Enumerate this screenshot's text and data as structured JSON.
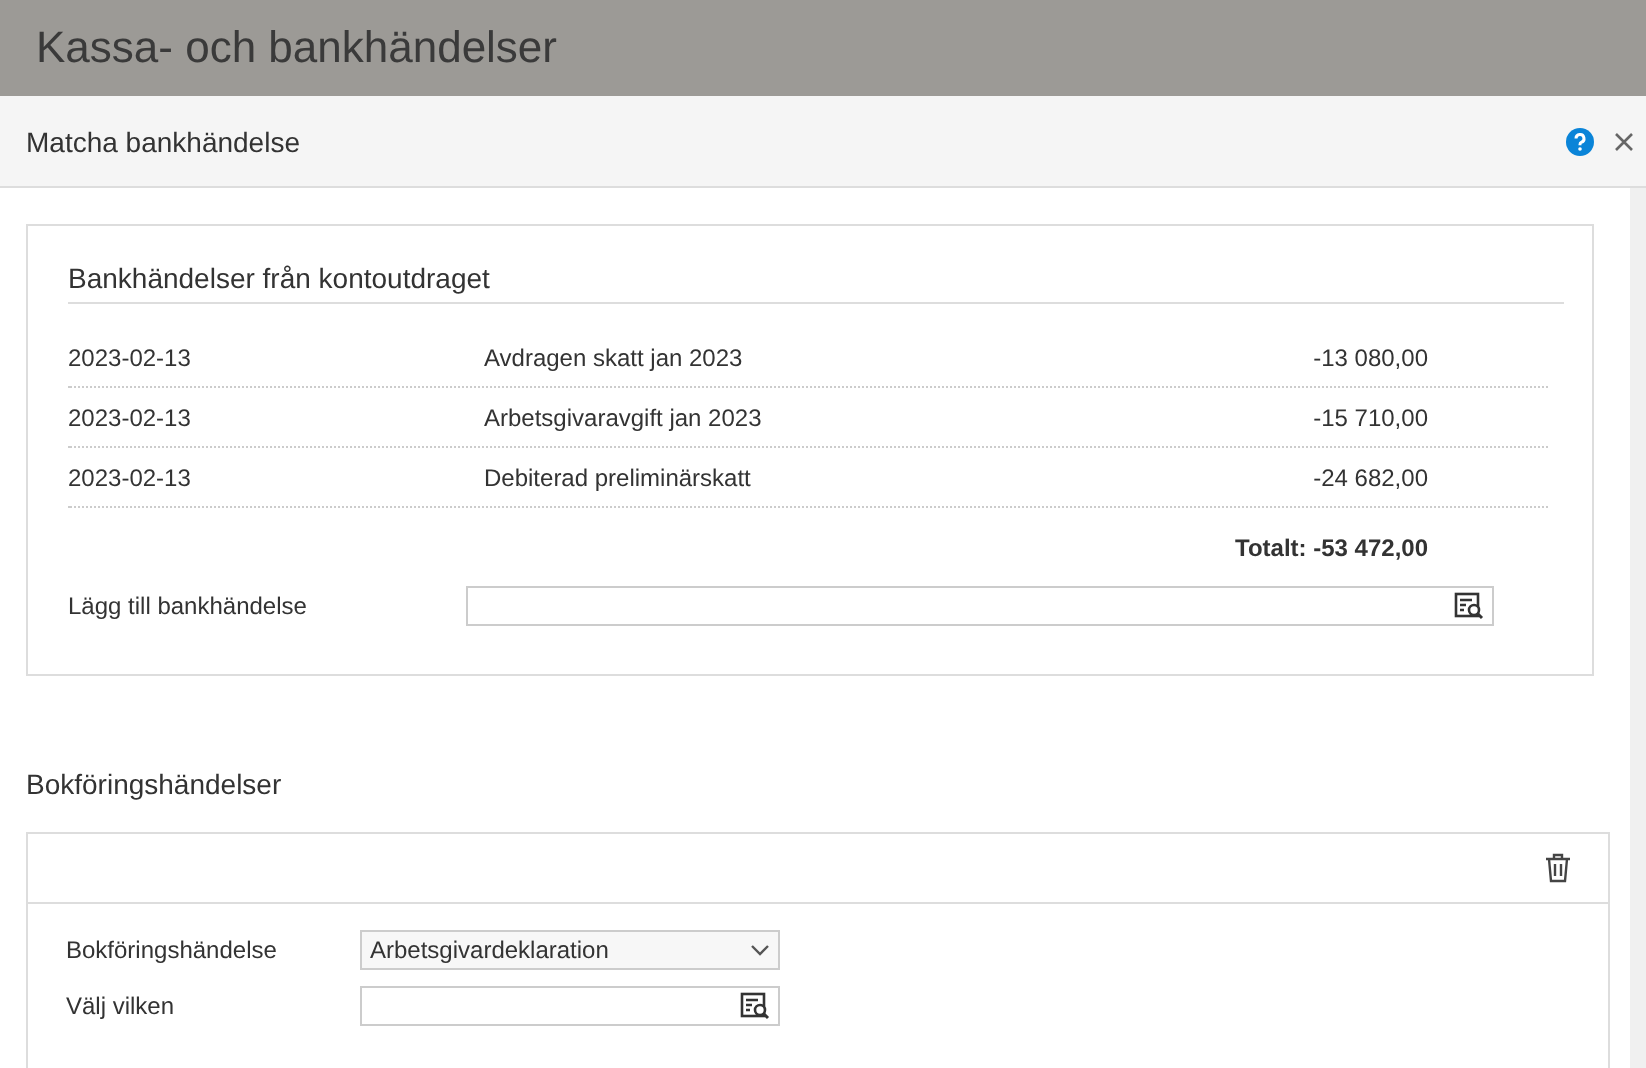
{
  "page": {
    "title": "Kassa- och bankhändelser"
  },
  "dialog": {
    "title": "Matcha bankhändelse"
  },
  "bank_transactions": {
    "title": "Bankhändelser från kontoutdraget",
    "rows": [
      {
        "date": "2023-02-13",
        "description": "Avdragen skatt jan 2023",
        "amount": "-13 080,00"
      },
      {
        "date": "2023-02-13",
        "description": "Arbetsgivaravgift jan 2023",
        "amount": "-15 710,00"
      },
      {
        "date": "2023-02-13",
        "description": "Debiterad preliminärskatt",
        "amount": "-24 682,00"
      }
    ],
    "total": "Totalt: -53 472,00",
    "add_label": "Lägg till bankhändelse"
  },
  "accounting_events": {
    "title": "Bokföringshändelser",
    "fields": [
      {
        "kind": "select",
        "label": "Bokföringshändelse",
        "value": "Arbetsgivardeklaration"
      },
      {
        "kind": "lookup",
        "label": "Välj vilken"
      }
    ]
  }
}
